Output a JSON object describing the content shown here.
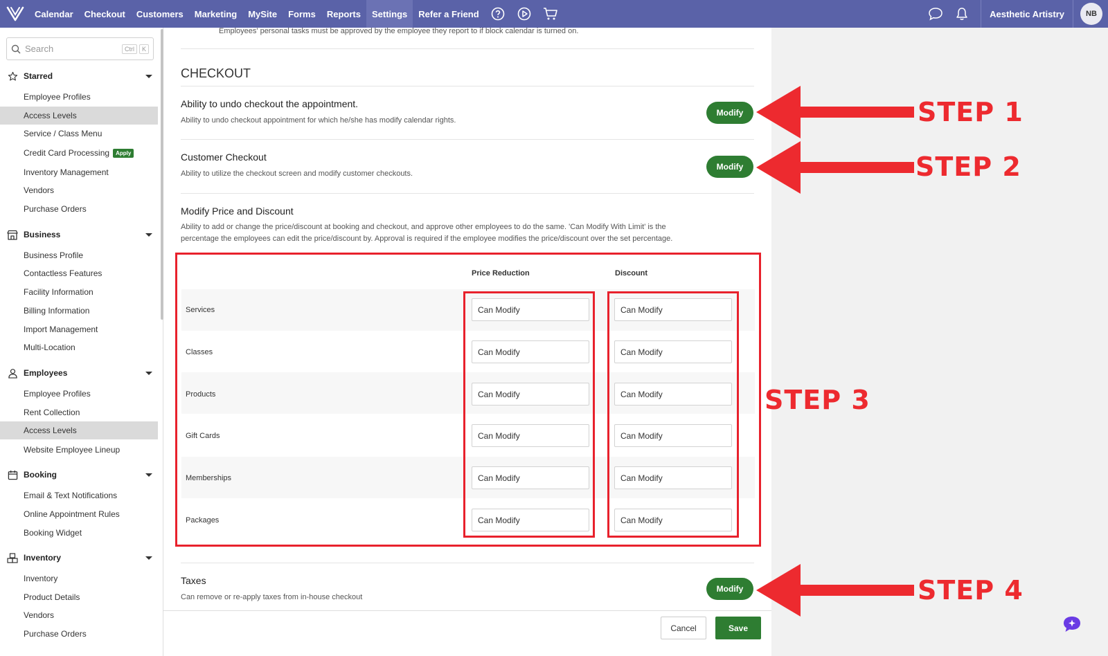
{
  "colors": {
    "nav_bg": "#5a62a8",
    "accent_green": "#2e7d32",
    "annotation_red": "#e8212c"
  },
  "topnav": {
    "logo_icon": "v-logo-icon",
    "links": [
      "Calendar",
      "Checkout",
      "Customers",
      "Marketing",
      "MySite",
      "Forms",
      "Reports",
      "Settings",
      "Refer a Friend"
    ],
    "active": "Settings",
    "icons": [
      "help-circle-icon",
      "play-circle-icon",
      "cart-icon"
    ],
    "right_icons": [
      "chat-icon",
      "bell-icon"
    ],
    "business_name": "Aesthetic Artistry",
    "avatar_initials": "NB"
  },
  "sidebar": {
    "search": {
      "placeholder": "Search",
      "shortcut_1": "Ctrl",
      "shortcut_2": "K"
    },
    "sections": [
      {
        "title": "Starred",
        "icon": "star-icon",
        "items": [
          "Employee Profiles",
          "Access Levels",
          "Service / Class Menu",
          "Credit Card Processing",
          "Inventory Management",
          "Vendors",
          "Purchase Orders"
        ]
      },
      {
        "title": "Business",
        "icon": "store-icon",
        "items": [
          "Business Profile",
          "Contactless Features",
          "Facility Information",
          "Billing Information",
          "Import Management",
          "Multi-Location"
        ]
      },
      {
        "title": "Employees",
        "icon": "person-icon",
        "items": [
          "Employee Profiles",
          "Rent Collection",
          "Access Levels",
          "Website Employee Lineup"
        ]
      },
      {
        "title": "Booking",
        "icon": "calendar-icon",
        "items": [
          "Email & Text Notifications",
          "Online Appointment Rules",
          "Booking Widget"
        ]
      },
      {
        "title": "Inventory",
        "icon": "boxes-icon",
        "items": [
          "Inventory",
          "Product Details",
          "Vendors",
          "Purchase Orders"
        ]
      }
    ],
    "apply_badge": "Apply"
  },
  "main": {
    "top_note": "Employees' personal tasks must be approved by the employee they report to if block calendar is turned on.",
    "section_title": "CHECKOUT",
    "permissions": [
      {
        "title": "Ability to undo checkout the appointment.",
        "desc": "Ability to undo checkout appointment for which he/she has modify calendar rights.",
        "button": "Modify"
      },
      {
        "title": "Customer Checkout",
        "desc": "Ability to utilize the checkout screen and modify customer checkouts.",
        "button": "Modify"
      },
      {
        "title": "Modify Price and Discount",
        "desc_line1": "Ability to add or change the price/discount at booking and checkout, and approve other employees to do the same. 'Can Modify With Limit' is the",
        "desc_line2": "percentage the employees can edit the price/discount by. Approval is required if the employee modifies the price/discount over the set percentage."
      },
      {
        "title": "Taxes",
        "desc": "Can remove or re-apply taxes from in-house checkout",
        "button": "Modify"
      }
    ],
    "table": {
      "col_price": "Price Reduction",
      "col_discount": "Discount",
      "rows": [
        {
          "label": "Services",
          "price": "Can Modify",
          "discount": "Can Modify"
        },
        {
          "label": "Classes",
          "price": "Can Modify",
          "discount": "Can Modify"
        },
        {
          "label": "Products",
          "price": "Can Modify",
          "discount": "Can Modify"
        },
        {
          "label": "Gift Cards",
          "price": "Can Modify",
          "discount": "Can Modify"
        },
        {
          "label": "Memberships",
          "price": "Can Modify",
          "discount": "Can Modify"
        },
        {
          "label": "Packages",
          "price": "Can Modify",
          "discount": "Can Modify"
        }
      ]
    }
  },
  "footer": {
    "cancel": "Cancel",
    "save": "Save"
  },
  "annotations": {
    "step1": "STEP 1",
    "step2": "STEP 2",
    "step3": "STEP 3",
    "step4": "STEP 4"
  },
  "chat_widget_icon": "ai-chat-icon"
}
